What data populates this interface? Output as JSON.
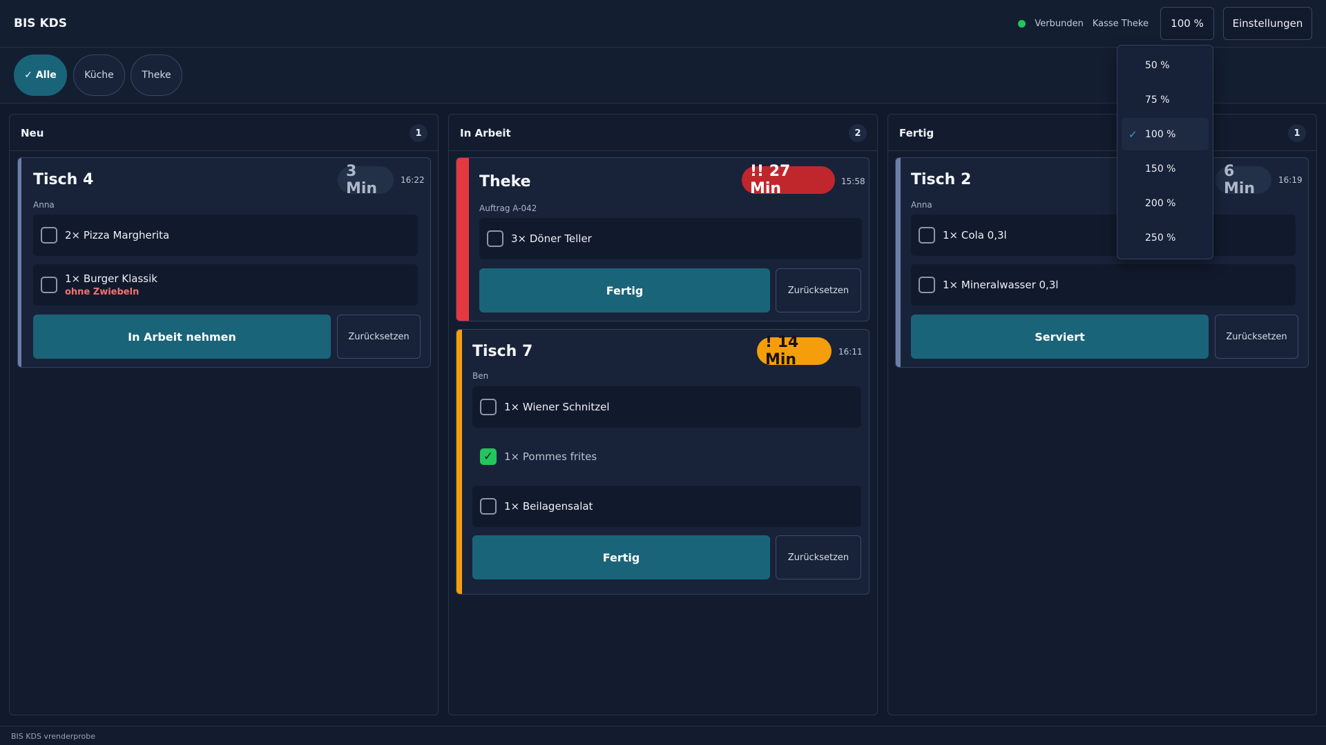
{
  "header": {
    "app_title": "BIS KDS",
    "connection_status": "Verbunden",
    "station": "Kasse Theke",
    "zoom_value": "100 %",
    "settings_label": "Einstellungen",
    "status_color": "#22c55e"
  },
  "filters": [
    {
      "label": "✓ Alle",
      "active": true
    },
    {
      "label": "Küche",
      "active": false
    },
    {
      "label": "Theke",
      "active": false
    }
  ],
  "columns": {
    "neu": {
      "title": "Neu",
      "count": "1",
      "cards": [
        {
          "title": "Tisch 4",
          "sub": "Anna",
          "timer": "3 Min",
          "time": "16:22",
          "items": [
            {
              "text": "2× Pizza Margherita",
              "checked": false
            },
            {
              "text": "1× Burger Klassik",
              "note": "ohne Zwiebeln",
              "checked": false
            }
          ],
          "primary": "In Arbeit nehmen",
          "secondary": "Zurücksetzen"
        }
      ]
    },
    "in_arbeit": {
      "title": "In Arbeit",
      "count": "2",
      "cards": [
        {
          "title": "Theke",
          "sub": "Auftrag A-042",
          "timer": "!! 27 Min",
          "time": "15:58",
          "items": [
            {
              "text": "3× Döner Teller",
              "checked": false
            }
          ],
          "primary": "Fertig",
          "secondary": "Zurücksetzen"
        },
        {
          "title": "Tisch 7",
          "sub": "Ben",
          "timer": "! 14 Min",
          "time": "16:11",
          "items": [
            {
              "text": "1× Wiener Schnitzel",
              "checked": false
            },
            {
              "text": "1× Pommes frites",
              "checked": true
            },
            {
              "text": "1× Beilagensalat",
              "checked": false
            }
          ],
          "primary": "Fertig",
          "secondary": "Zurücksetzen"
        }
      ]
    },
    "fertig": {
      "title": "Fertig",
      "count": "1",
      "cards": [
        {
          "title": "Tisch 2",
          "sub": "Anna",
          "timer": "6 Min",
          "time": "16:19",
          "items": [
            {
              "text": "1× Cola 0,3l",
              "checked": false
            },
            {
              "text": "1× Mineralwasser 0,3l",
              "checked": false
            }
          ],
          "primary": "Serviert",
          "secondary": "Zurücksetzen"
        }
      ]
    }
  },
  "zoom_menu": {
    "options": [
      "50 %",
      "75 %",
      "100 %",
      "150 %",
      "200 %",
      "250 %"
    ],
    "selected": "100 %",
    "check_glyph": "✓"
  },
  "colors": {
    "accent": "#1a6479",
    "urgent": "#c0272d",
    "warning": "#f59e0b",
    "done_check": "#22c55e",
    "note": "#f87171"
  },
  "footer": {
    "text": "BIS KDS vrenderprobe"
  }
}
